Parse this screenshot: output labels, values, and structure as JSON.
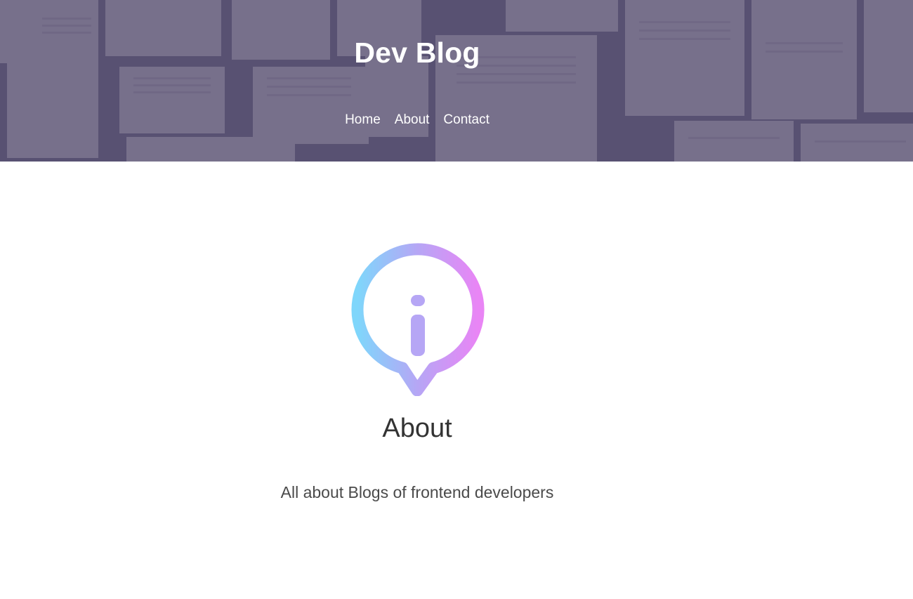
{
  "header": {
    "site_title": "Dev Blog",
    "nav": [
      {
        "label": "Home"
      },
      {
        "label": "About"
      },
      {
        "label": "Contact"
      }
    ]
  },
  "main": {
    "icon": "info-bubble-icon",
    "heading": "About",
    "description": "All about Blogs of frontend developers"
  },
  "colors": {
    "overlay": "#3a345c",
    "icon_gradient_start": "#7fd6fb",
    "icon_gradient_mid": "#b6a6f5",
    "icon_gradient_end": "#e985f5",
    "heading": "#333333",
    "text": "#4a4a4a"
  }
}
